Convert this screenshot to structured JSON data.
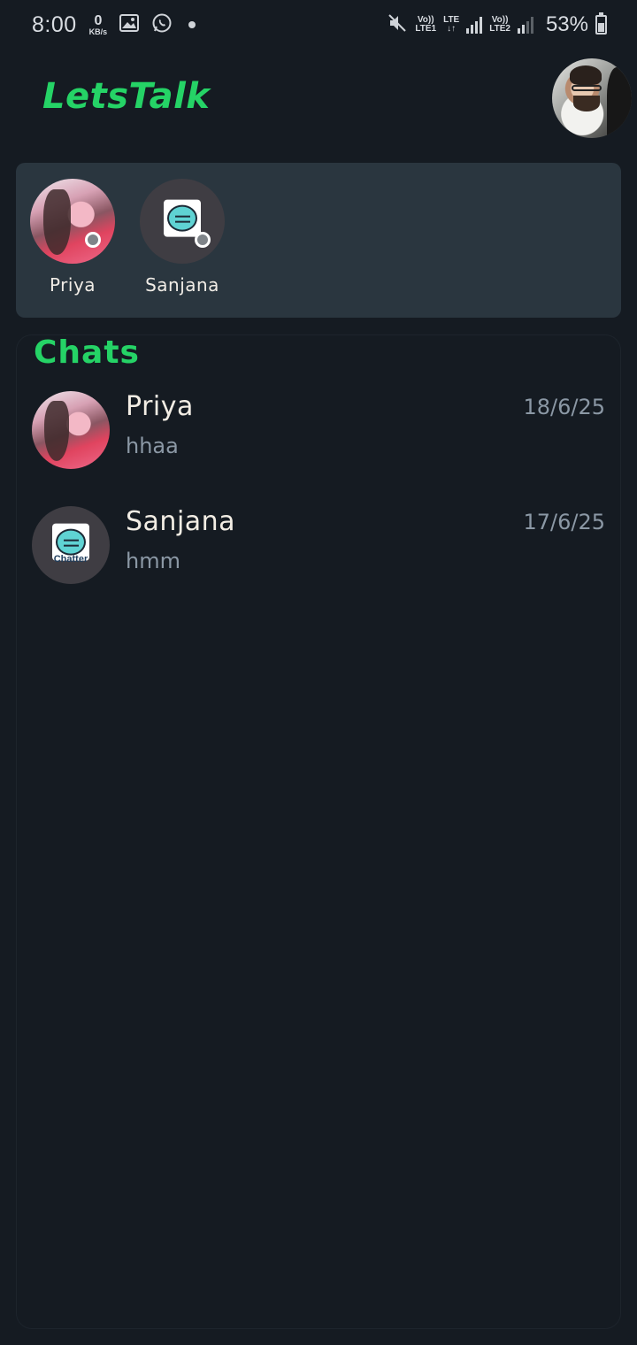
{
  "status_bar": {
    "time": "8:00",
    "data_speed_value": "0",
    "data_speed_unit": "KB/s",
    "sim1_label_top": "Vo))",
    "sim1_label_bottom": "LTE1",
    "lte_label_top": "LTE",
    "lte_label_bottom": "↓↑",
    "sim2_label_top": "Vo))",
    "sim2_label_bottom": "LTE2",
    "battery_percent": "53%",
    "icons": [
      "gallery-icon",
      "whatsapp-icon",
      "notification-dot-icon",
      "mute-icon",
      "signal-icon",
      "battery-icon"
    ]
  },
  "header": {
    "app_title": "LetsTalk",
    "accent_color": "#25d366"
  },
  "stories": [
    {
      "name": "Priya",
      "image": "priya-photo"
    },
    {
      "name": "Sanjana",
      "image": "chatter-logo"
    }
  ],
  "chats": {
    "title": "Chats",
    "items": [
      {
        "name": "Priya",
        "last_message": "hhaa",
        "date": "18/6/25",
        "image": "priya-photo"
      },
      {
        "name": "Sanjana",
        "last_message": "hmm",
        "date": "17/6/25",
        "image": "chatter-logo"
      }
    ]
  },
  "logo_text": "Chatter"
}
